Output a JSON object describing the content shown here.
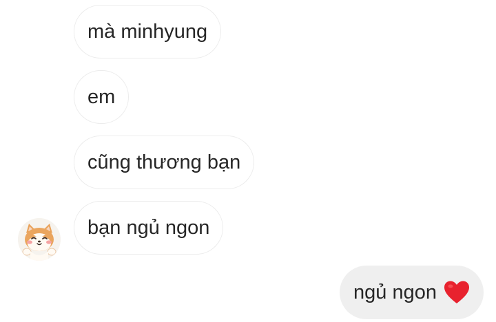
{
  "messages": {
    "received": [
      {
        "text": "mà minhyung"
      },
      {
        "text": "em"
      },
      {
        "text": "cũng thương bạn"
      },
      {
        "text": "bạn ngủ ngon"
      }
    ],
    "sent": [
      {
        "text": "ngủ ngon",
        "emoji": "red-heart"
      }
    ]
  },
  "avatar": {
    "icon": "shiba-dog-sticker-avatar"
  },
  "colors": {
    "received_bubble_bg": "#ffffff",
    "received_bubble_border": "#ececec",
    "sent_bubble_bg": "#efefef",
    "text": "#262626",
    "heart": "#e8222e"
  }
}
